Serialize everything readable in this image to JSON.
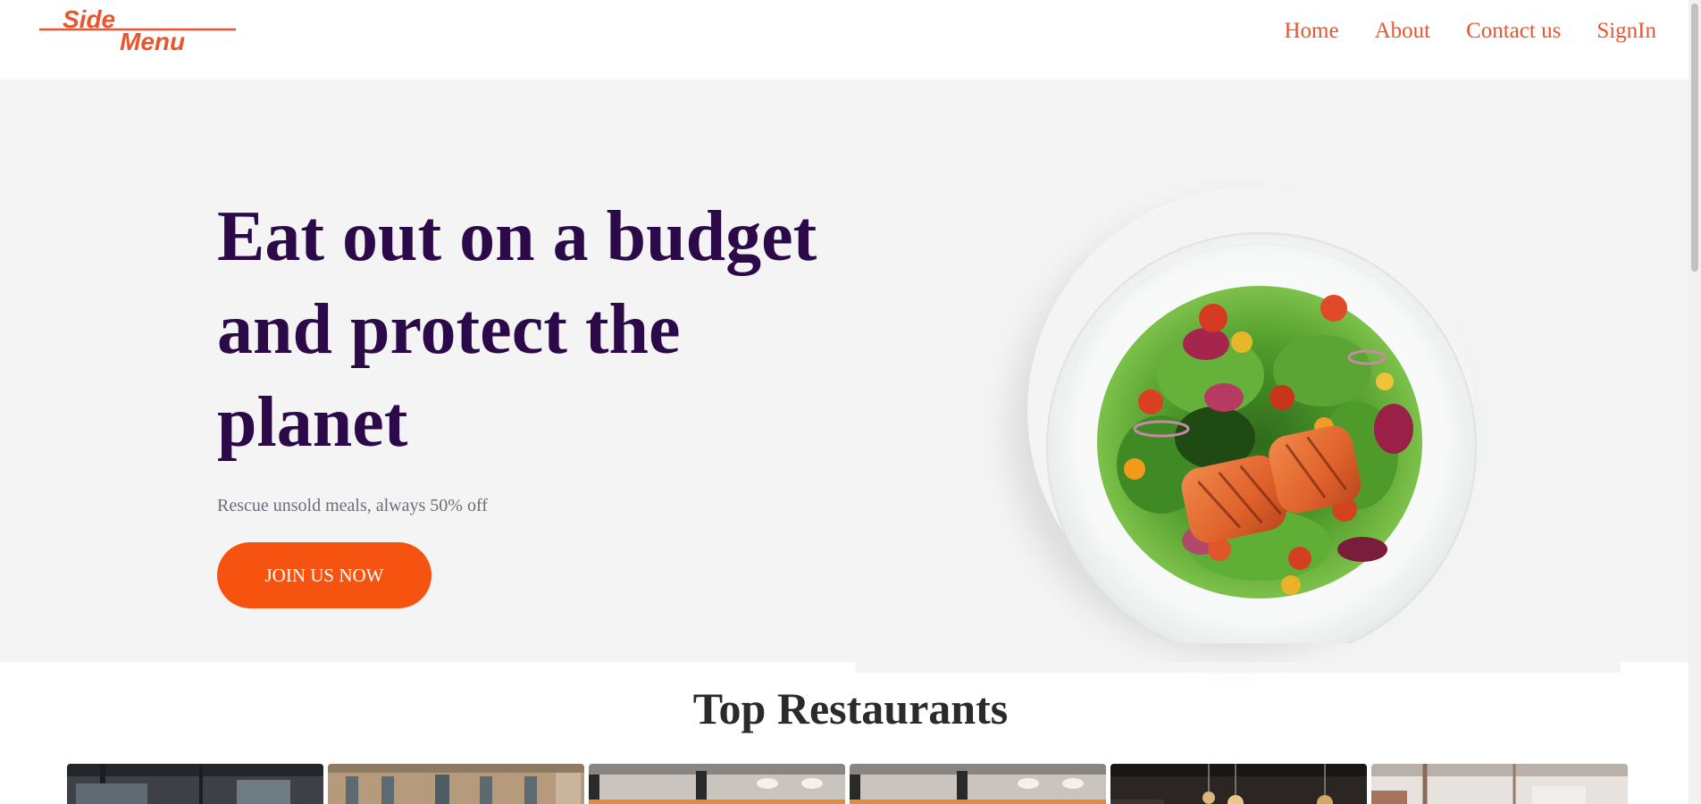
{
  "header": {
    "logo_alt": "Side Menu",
    "logo_line1": "Side",
    "logo_line2": "Menu",
    "nav": [
      {
        "label": "Home"
      },
      {
        "label": "About"
      },
      {
        "label": "Contact us"
      },
      {
        "label": "SignIn"
      }
    ]
  },
  "hero": {
    "title": "Eat out on a budget and protect the planet",
    "subtitle": "Rescue unsold meals, always 50% off",
    "cta_label": "JOIN US NOW",
    "image": "salmon-salad-plate"
  },
  "restaurants": {
    "title": "Top Restaurants",
    "cards": [
      {
        "image": "restaurant-dark-interior"
      },
      {
        "image": "restaurant-stone-building"
      },
      {
        "image": "restaurant-orange-kitchen"
      },
      {
        "image": "restaurant-orange-kitchen-2"
      },
      {
        "image": "restaurant-pendant-lights"
      },
      {
        "image": "restaurant-bright-ceiling"
      }
    ]
  },
  "colors": {
    "accent": "#f5530f",
    "nav": "#e8552f",
    "title": "#2c0a4a",
    "hero_bg": "#f4f4f4"
  }
}
